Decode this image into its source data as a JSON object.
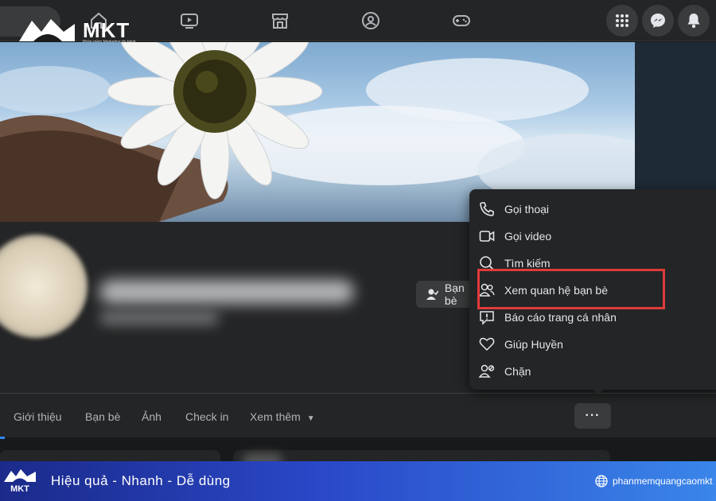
{
  "brand": {
    "logo_text": "MKT",
    "logo_subtitle": "Phần mềm Marketing đa kênh"
  },
  "topnav": {
    "icons": [
      "home-icon",
      "watch-icon",
      "marketplace-icon",
      "groups-icon",
      "gaming-icon"
    ],
    "right_icons": [
      "menu-grid-icon",
      "messenger-icon",
      "notifications-icon"
    ]
  },
  "profile": {
    "friends_button_label": "Bạn bè"
  },
  "tabs": [
    {
      "label": "Giới thiệu"
    },
    {
      "label": "Bạn bè"
    },
    {
      "label": "Ảnh"
    },
    {
      "label": "Check in"
    },
    {
      "label": "Xem thêm"
    }
  ],
  "more_button_label": "···",
  "menu": {
    "items": [
      {
        "label": "Gọi thoại",
        "icon": "phone-icon"
      },
      {
        "label": "Gọi video",
        "icon": "video-icon"
      },
      {
        "label": "Tìm kiếm",
        "icon": "search-icon"
      },
      {
        "label": "Xem quan hệ bạn bè",
        "icon": "friends-icon"
      },
      {
        "label": "Báo cáo trang cá nhân",
        "icon": "report-icon"
      },
      {
        "label": "Giúp Huyền",
        "icon": "heart-icon"
      },
      {
        "label": "Chặn",
        "icon": "block-user-icon"
      }
    ],
    "highlight_color": "#e03a3a"
  },
  "promo": {
    "logo_text": "MKT",
    "tagline": "Hiệu quả - Nhanh  - Dễ dùng",
    "website": "phanmemquangcaomkt"
  }
}
